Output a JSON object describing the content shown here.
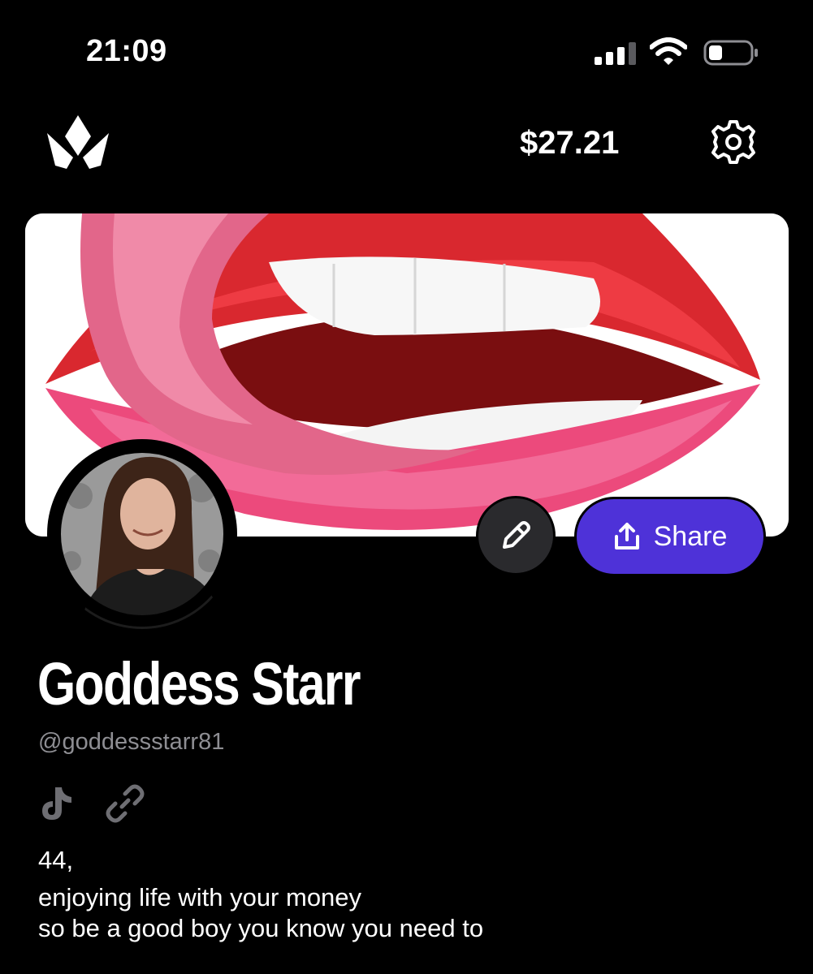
{
  "status_bar": {
    "time": "21:09",
    "signal_icon": "cellular-signal-icon",
    "wifi_icon": "wifi-icon",
    "battery_icon": "battery-low-icon"
  },
  "header": {
    "logo_icon": "crown-logo-icon",
    "balance": "$27.21",
    "settings_icon": "gear-icon"
  },
  "banner": {
    "image": "lips-licking-illustration"
  },
  "profile": {
    "avatar": "profile-photo",
    "edit_icon": "pencil-icon",
    "share_label": "Share",
    "share_icon": "upload-share-icon",
    "display_name": "Goddess Starr",
    "username": "@goddessstarr81",
    "social_icons": [
      "tiktok-icon",
      "link-icon"
    ],
    "bio": [
      "44,",
      "enjoying life with your money",
      "so be a good boy you know you need to"
    ]
  },
  "colors": {
    "background": "#000000",
    "share_button": "#4e32d8",
    "edit_button": "#2a2a2d",
    "muted_text": "#8e8e93"
  }
}
